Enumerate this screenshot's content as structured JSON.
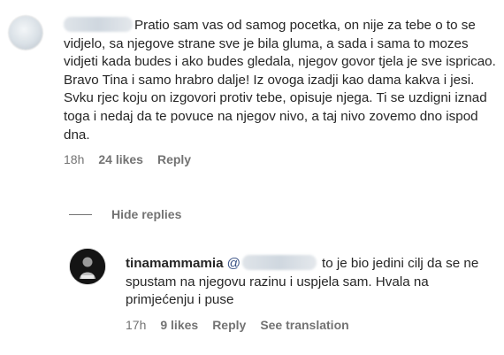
{
  "comments": [
    {
      "text": "Pratio sam vas od samog pocetka, on nije za tebe o to se vidjelo, sa njegove strane sve je bila gluma, a sada i sama to mozes vidjeti kada budes i ako budes gledala, njegov govor tjela je sve ispricao. Bravo Tina i samo hrabro dalje! Iz ovoga izadji kao dama kakva i jesi. Svku rjec koju on izgovori protiv tebe, opisuje njega. Ti se uzdigni iznad toga i nedaj da te povuce na njegov nivo, a taj nivo zovemo dno ispod dna.",
      "time": "18h",
      "likes": "24 likes",
      "reply_label": "Reply"
    },
    {
      "username": "tinamammamia",
      "mention_prefix": "@",
      "text": "to je bio jedini cilj da se ne spustam na njegovu razinu i uspjela sam. Hvala na primjećenju i puse",
      "time": "17h",
      "likes": "9 likes",
      "reply_label": "Reply",
      "translation_label": "See translation"
    }
  ],
  "hide_replies_label": "Hide replies",
  "colors": {
    "text": "#262626",
    "secondary": "#737373",
    "mention": "#385185"
  }
}
